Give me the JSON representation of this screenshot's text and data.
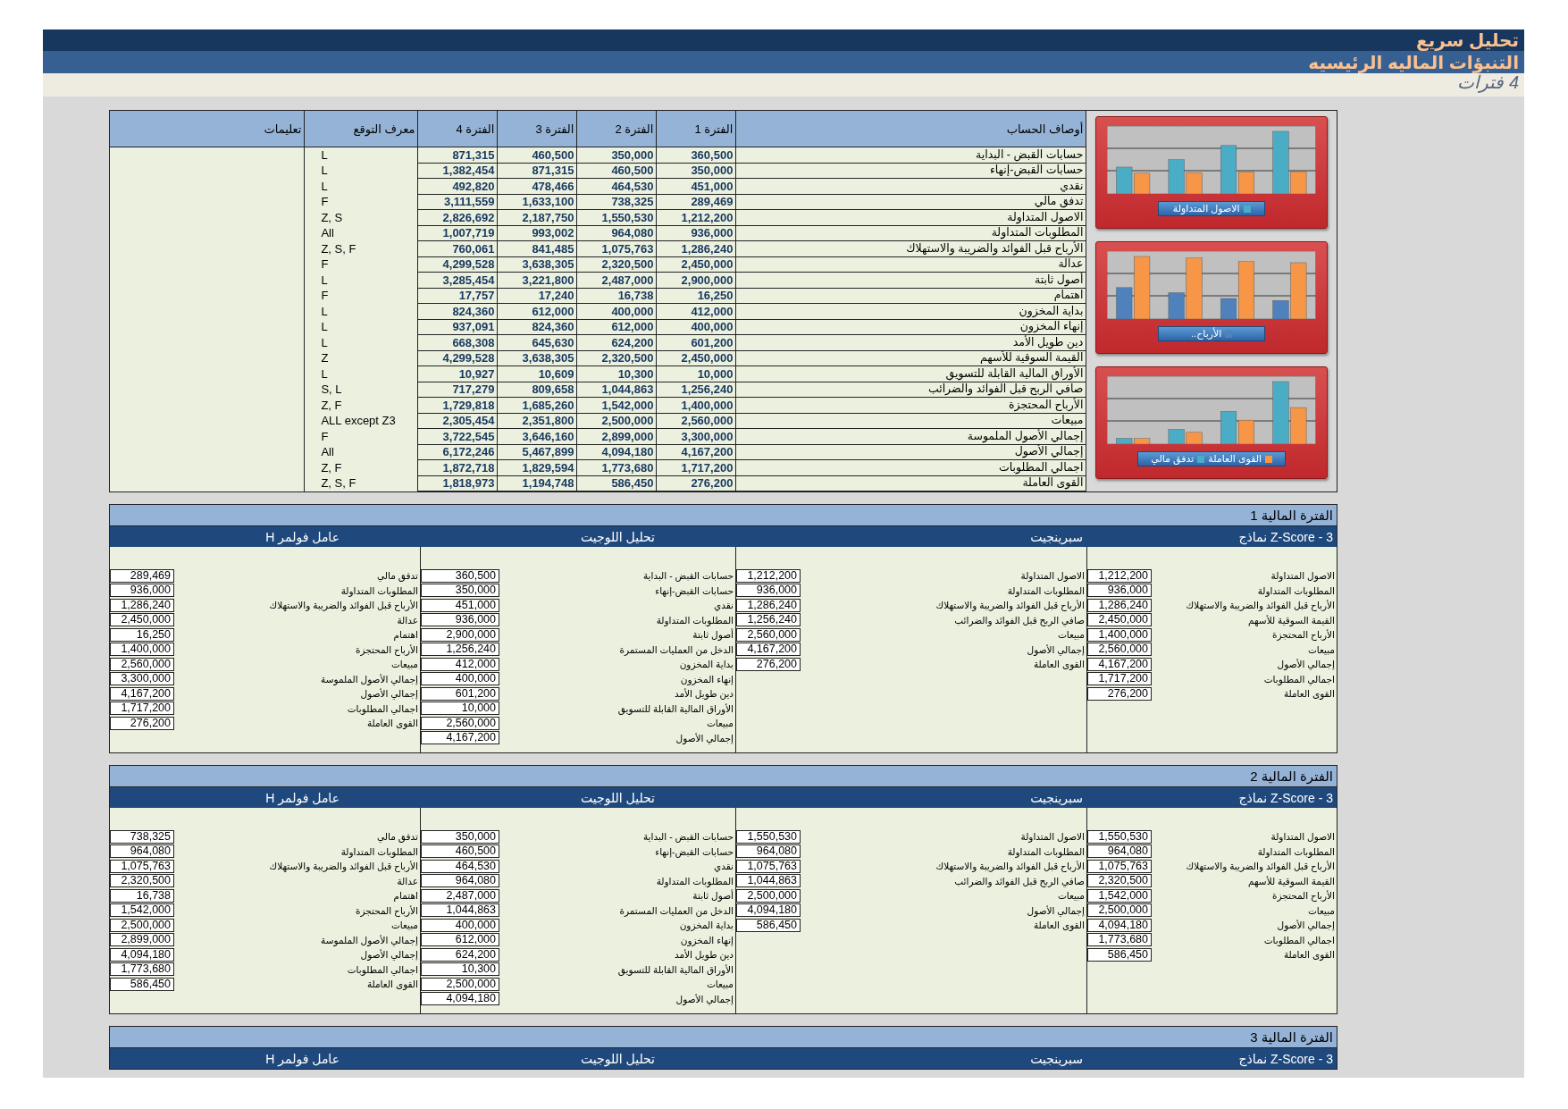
{
  "header": {
    "title": "تحليل سريع",
    "subtitle": "التنبؤات الماليه الرئيسيه",
    "note": "4 فترات"
  },
  "forecast_table": {
    "columns": [
      "أوصاف الحساب",
      "الفترة 1",
      "الفترة 2",
      "الفترة 3",
      "الفترة 4",
      "معرف التوقع",
      "تعليمات"
    ],
    "rows": [
      {
        "description": "حسابات القبض - البداية",
        "values": [
          "360,500",
          "350,000",
          "460,500",
          "871,315"
        ],
        "identifier": "L"
      },
      {
        "description": "حسابات القبض-إنهاء",
        "values": [
          "350,000",
          "460,500",
          "871,315",
          "1,382,454"
        ],
        "identifier": "L"
      },
      {
        "description": "نقدي",
        "values": [
          "451,000",
          "464,530",
          "478,466",
          "492,820"
        ],
        "identifier": "L"
      },
      {
        "description": "تدفق مالي",
        "values": [
          "289,469",
          "738,325",
          "1,633,100",
          "3,111,559"
        ],
        "identifier": "F"
      },
      {
        "description": "الاصول المتداولة",
        "values": [
          "1,212,200",
          "1,550,530",
          "2,187,750",
          "2,826,692"
        ],
        "identifier": "Z, S"
      },
      {
        "description": "المطلوبات المتداولة",
        "values": [
          "936,000",
          "964,080",
          "993,002",
          "1,007,719"
        ],
        "identifier": "All"
      },
      {
        "description": "الأرباح قبل الفوائد والضريبة والاستهلاك",
        "values": [
          "1,286,240",
          "1,075,763",
          "841,485",
          "760,061"
        ],
        "identifier": "Z, S, F"
      },
      {
        "description": "عدالة",
        "values": [
          "2,450,000",
          "2,320,500",
          "3,638,305",
          "4,299,528"
        ],
        "identifier": "F"
      },
      {
        "description": "أصول ثابتة",
        "values": [
          "2,900,000",
          "2,487,000",
          "3,221,800",
          "3,285,454"
        ],
        "identifier": "L"
      },
      {
        "description": "اهتمام",
        "values": [
          "16,250",
          "16,738",
          "17,240",
          "17,757"
        ],
        "identifier": "F"
      },
      {
        "description": "بداية المخزون",
        "values": [
          "412,000",
          "400,000",
          "612,000",
          "824,360"
        ],
        "identifier": "L"
      },
      {
        "description": "إنهاء المخزون",
        "values": [
          "400,000",
          "612,000",
          "824,360",
          "937,091"
        ],
        "identifier": "L"
      },
      {
        "description": "دين طويل الأمد",
        "values": [
          "601,200",
          "624,200",
          "645,630",
          "668,308"
        ],
        "identifier": "L"
      },
      {
        "description": "القيمة السوقية للأسهم",
        "values": [
          "2,450,000",
          "2,320,500",
          "3,638,305",
          "4,299,528"
        ],
        "identifier": "Z"
      },
      {
        "description": "الأوراق المالية القابلة للتسويق",
        "values": [
          "10,000",
          "10,300",
          "10,609",
          "10,927"
        ],
        "identifier": "L"
      },
      {
        "description": "صافي الربح قبل الفوائد والضرائب",
        "values": [
          "1,256,240",
          "1,044,863",
          "809,658",
          "717,279"
        ],
        "identifier": "S, L"
      },
      {
        "description": "الأرباح المحتجزة",
        "values": [
          "1,400,000",
          "1,542,000",
          "1,685,260",
          "1,729,818"
        ],
        "identifier": "Z, F"
      },
      {
        "description": "مبيعات",
        "values": [
          "2,560,000",
          "2,500,000",
          "2,351,800",
          "2,305,454"
        ],
        "identifier": "ALL except Z3"
      },
      {
        "description": "إجمالي الأصول الملموسة",
        "values": [
          "3,300,000",
          "2,899,000",
          "3,646,160",
          "3,722,545"
        ],
        "identifier": "F"
      },
      {
        "description": "إجمالي الأصول",
        "values": [
          "4,167,200",
          "4,094,180",
          "5,467,899",
          "6,172,246"
        ],
        "identifier": "All"
      },
      {
        "description": "اجمالي المطلوبات",
        "values": [
          "1,717,200",
          "1,773,680",
          "1,829,594",
          "1,872,718"
        ],
        "identifier": "Z, F"
      },
      {
        "description": "القوى العاملة",
        "values": [
          "276,200",
          "586,450",
          "1,194,748",
          "1,818,973"
        ],
        "identifier": "Z, S, F"
      }
    ]
  },
  "charts": [
    {
      "legend": [
        {
          "label": "الاصول المتداولة",
          "color": "#4bacc6"
        }
      ]
    },
    {
      "legend": [
        {
          "label": "الأرباح..",
          "color": "#4f81bd"
        }
      ]
    },
    {
      "legend": [
        {
          "label": "القوى العاملة",
          "color": "#f79646"
        },
        {
          "label": "تدفق مالي",
          "color": "#4bacc6"
        }
      ]
    }
  ],
  "periods": [
    {
      "title": "الفترة المالية 1",
      "models": [
        {
          "title": "Z-Score - 3 نماذج",
          "items": [
            {
              "label": "الاصول المتداولة",
              "value": "1,212,200"
            },
            {
              "label": "المطلوبات المتداولة",
              "value": "936,000"
            },
            {
              "label": "الأرباح قبل الفوائد والضريبة والاستهلاك",
              "value": "1,286,240"
            },
            {
              "label": "القيمة السوقية للأسهم",
              "value": "2,450,000"
            },
            {
              "label": "الأرباح المحتجزة",
              "value": "1,400,000"
            },
            {
              "label": "مبيعات",
              "value": "2,560,000"
            },
            {
              "label": "إجمالي الأصول",
              "value": "4,167,200"
            },
            {
              "label": "اجمالي المطلوبات",
              "value": "1,717,200"
            },
            {
              "label": "القوى العاملة",
              "value": "276,200"
            }
          ]
        },
        {
          "title": "سبرينجيت",
          "items": [
            {
              "label": "الاصول المتداولة",
              "value": "1,212,200"
            },
            {
              "label": "المطلوبات المتداولة",
              "value": "936,000"
            },
            {
              "label": "الأرباح قبل الفوائد والضريبة والاستهلاك",
              "value": "1,286,240"
            },
            {
              "label": "صافي الربح قبل الفوائد والضرائب",
              "value": "1,256,240"
            },
            {
              "label": "مبيعات",
              "value": "2,560,000"
            },
            {
              "label": "إجمالي الأصول",
              "value": "4,167,200"
            },
            {
              "label": "القوى العاملة",
              "value": "276,200"
            }
          ]
        },
        {
          "title": "تحليل اللوجيت",
          "items": [
            {
              "label": "حسابات القبض - البداية",
              "value": "360,500"
            },
            {
              "label": "حسابات القبض-إنهاء",
              "value": "350,000"
            },
            {
              "label": "نقدي",
              "value": "451,000"
            },
            {
              "label": "المطلوبات المتداولة",
              "value": "936,000"
            },
            {
              "label": "أصول ثابتة",
              "value": "2,900,000"
            },
            {
              "label": "الدخل من العمليات المستمرة",
              "value": "1,256,240"
            },
            {
              "label": "بداية المخزون",
              "value": "412,000"
            },
            {
              "label": "إنهاء المخزون",
              "value": "400,000"
            },
            {
              "label": "دين طويل الأمد",
              "value": "601,200"
            },
            {
              "label": "الأوراق المالية القابلة للتسويق",
              "value": "10,000"
            },
            {
              "label": "مبيعات",
              "value": "2,560,000"
            },
            {
              "label": "إجمالي الأصول",
              "value": "4,167,200"
            }
          ]
        },
        {
          "title": "عامل فولمر H",
          "items": [
            {
              "label": "تدفق مالي",
              "value": "289,469"
            },
            {
              "label": "المطلوبات المتداولة",
              "value": "936,000"
            },
            {
              "label": "الأرباح قبل الفوائد والضريبة والاستهلاك",
              "value": "1,286,240"
            },
            {
              "label": "عدالة",
              "value": "2,450,000"
            },
            {
              "label": "اهتمام",
              "value": "16,250"
            },
            {
              "label": "الأرباح المحتجزة",
              "value": "1,400,000"
            },
            {
              "label": "مبيعات",
              "value": "2,560,000"
            },
            {
              "label": "إجمالي الأصول الملموسة",
              "value": "3,300,000"
            },
            {
              "label": "إجمالي الأصول",
              "value": "4,167,200"
            },
            {
              "label": "اجمالي المطلوبات",
              "value": "1,717,200"
            },
            {
              "label": "القوى العاملة",
              "value": "276,200"
            }
          ]
        }
      ]
    },
    {
      "title": "الفترة المالية 2",
      "models": [
        {
          "title": "Z-Score - 3 نماذج",
          "items": [
            {
              "label": "الاصول المتداولة",
              "value": "1,550,530"
            },
            {
              "label": "المطلوبات المتداولة",
              "value": "964,080"
            },
            {
              "label": "الأرباح قبل الفوائد والضريبة والاستهلاك",
              "value": "1,075,763"
            },
            {
              "label": "القيمة السوقية للأسهم",
              "value": "2,320,500"
            },
            {
              "label": "الأرباح المحتجزة",
              "value": "1,542,000"
            },
            {
              "label": "مبيعات",
              "value": "2,500,000"
            },
            {
              "label": "إجمالي الأصول",
              "value": "4,094,180"
            },
            {
              "label": "اجمالي المطلوبات",
              "value": "1,773,680"
            },
            {
              "label": "القوى العاملة",
              "value": "586,450"
            }
          ]
        },
        {
          "title": "سبرينجيت",
          "items": [
            {
              "label": "الاصول المتداولة",
              "value": "1,550,530"
            },
            {
              "label": "المطلوبات المتداولة",
              "value": "964,080"
            },
            {
              "label": "الأرباح قبل الفوائد والضريبة والاستهلاك",
              "value": "1,075,763"
            },
            {
              "label": "صافي الربح قبل الفوائد والضرائب",
              "value": "1,044,863"
            },
            {
              "label": "مبيعات",
              "value": "2,500,000"
            },
            {
              "label": "إجمالي الأصول",
              "value": "4,094,180"
            },
            {
              "label": "القوى العاملة",
              "value": "586,450"
            }
          ]
        },
        {
          "title": "تحليل اللوجيت",
          "items": [
            {
              "label": "حسابات القبض - البداية",
              "value": "350,000"
            },
            {
              "label": "حسابات القبض-إنهاء",
              "value": "460,500"
            },
            {
              "label": "نقدي",
              "value": "464,530"
            },
            {
              "label": "المطلوبات المتداولة",
              "value": "964,080"
            },
            {
              "label": "أصول ثابتة",
              "value": "2,487,000"
            },
            {
              "label": "الدخل من العمليات المستمرة",
              "value": "1,044,863"
            },
            {
              "label": "بداية المخزون",
              "value": "400,000"
            },
            {
              "label": "إنهاء المخزون",
              "value": "612,000"
            },
            {
              "label": "دين طويل الأمد",
              "value": "624,200"
            },
            {
              "label": "الأوراق المالية القابلة للتسويق",
              "value": "10,300"
            },
            {
              "label": "مبيعات",
              "value": "2,500,000"
            },
            {
              "label": "إجمالي الأصول",
              "value": "4,094,180"
            }
          ]
        },
        {
          "title": "عامل فولمر H",
          "items": [
            {
              "label": "تدفق مالي",
              "value": "738,325"
            },
            {
              "label": "المطلوبات المتداولة",
              "value": "964,080"
            },
            {
              "label": "الأرباح قبل الفوائد والضريبة والاستهلاك",
              "value": "1,075,763"
            },
            {
              "label": "عدالة",
              "value": "2,320,500"
            },
            {
              "label": "اهتمام",
              "value": "16,738"
            },
            {
              "label": "الأرباح المحتجزة",
              "value": "1,542,000"
            },
            {
              "label": "مبيعات",
              "value": "2,500,000"
            },
            {
              "label": "إجمالي الأصول الملموسة",
              "value": "2,899,000"
            },
            {
              "label": "إجمالي الأصول",
              "value": "4,094,180"
            },
            {
              "label": "اجمالي المطلوبات",
              "value": "1,773,680"
            },
            {
              "label": "القوى العاملة",
              "value": "586,450"
            }
          ]
        }
      ]
    },
    {
      "title": "الفترة المالية 3",
      "models": [
        {
          "title": "Z-Score - 3 نماذج"
        },
        {
          "title": "سبرينجيت"
        },
        {
          "title": "تحليل اللوجيت"
        },
        {
          "title": "عامل فولمر H"
        }
      ]
    }
  ]
}
